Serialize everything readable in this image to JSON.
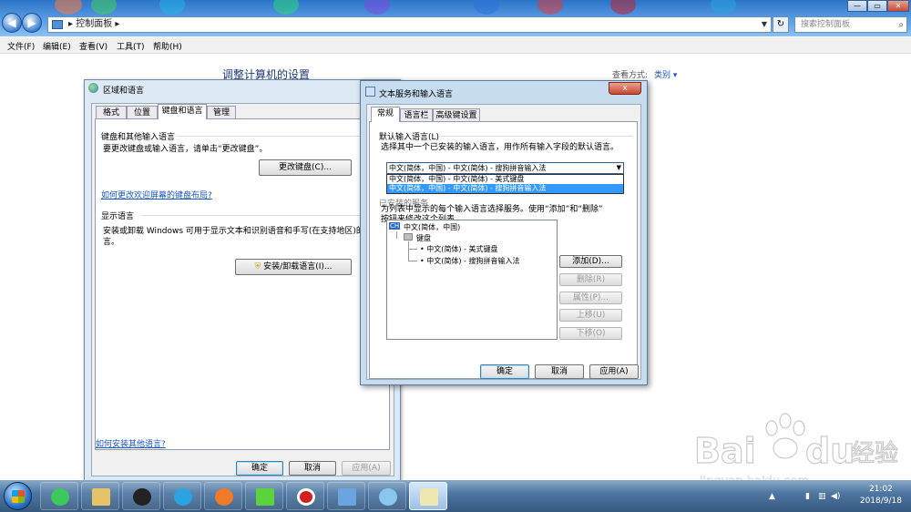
{
  "explorer": {
    "address": "控制面板",
    "search_placeholder": "搜索控制面板",
    "window_buttons": [
      "—",
      "▭",
      "✕"
    ],
    "menu": [
      "文件(F)",
      "编辑(E)",
      "查看(V)",
      "工具(T)",
      "帮助(H)"
    ],
    "page_title": "调整计算机的设置",
    "view_by_label": "查看方式:",
    "view_by_value": "类别"
  },
  "region_dialog": {
    "title": "区域和语言",
    "tabs": [
      "格式",
      "位置",
      "键盘和语言",
      "管理"
    ],
    "selected_tab": "键盘和语言",
    "kb_group_title": "键盘和其他输入语言",
    "kb_group_desc": "要更改键盘或输入语言，请单击“更改键盘”。",
    "change_keyboard_btn": "更改键盘(C)...",
    "welcome_link": "如何更改欢迎屏幕的键盘布局?",
    "display_group_title": "显示语言",
    "display_desc_1": "安装或卸载 Windows 可用于显示文本和识别语音和手写(在支持地区)的语",
    "display_desc_2": "言。",
    "install_btn": "安装/卸载语言(I)...",
    "more_lang_link": "如何安装其他语言?",
    "ok": "确定",
    "cancel": "取消",
    "apply": "应用(A)"
  },
  "text_services_dialog": {
    "title": "文本服务和输入语言",
    "close": "x",
    "tabs": [
      "常规",
      "语言栏",
      "高级键设置"
    ],
    "selected_tab": "常规",
    "default_group_title": "默认输入语言(L)",
    "default_group_desc": "选择其中一个已安装的输入语言，用作所有输入字段的默认语言。",
    "combo_value": "中文(简体，中国) - 中文(简体) - 搜狗拼音输入法",
    "dropdown_options": [
      "中文(简体，中国) - 中文(简体) - 美式键盘",
      "中文(简体，中国) - 中文(简体) - 搜狗拼音输入法"
    ],
    "selected_option": 1,
    "services_title_partial": "已安装的服务",
    "services_desc_1": "为列表中显示的每个输入语言选择服务。使用“添加”和“删除”",
    "services_desc_2": "按钮来修改这个列表。",
    "tree": {
      "lang_badge": "CH",
      "language": "中文(简体，中国)",
      "keyboard": "键盘",
      "items": [
        "中文(简体) - 美式键盘",
        "中文(简体) - 搜狗拼音输入法"
      ]
    },
    "add_btn": "添加(D)...",
    "remove_btn": "删除(R)",
    "props_btn": "属性(P)...",
    "up_btn": "上移(U)",
    "down_btn": "下移(O)",
    "ok": "确定",
    "cancel": "取消",
    "apply": "应用(A)"
  },
  "taskbar": {
    "time": "21:02",
    "date": "2018/9/18"
  }
}
